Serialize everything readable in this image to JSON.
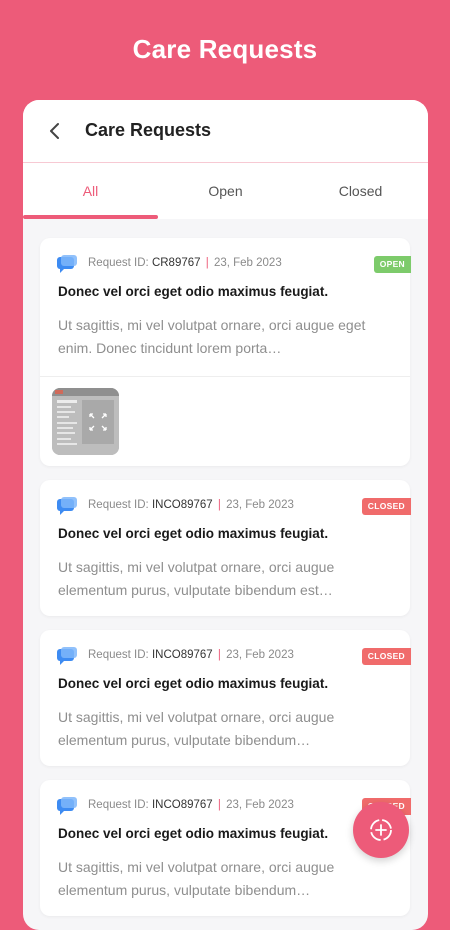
{
  "app": {
    "title": "Care Requests",
    "accent_color": "#ED5B79"
  },
  "header": {
    "title": "Care Requests",
    "back_icon": "chevron-left-icon"
  },
  "tabs": [
    {
      "label": "All",
      "active": true
    },
    {
      "label": "Open",
      "active": false
    },
    {
      "label": "Closed",
      "active": false
    }
  ],
  "requests": [
    {
      "id_label": "Request ID:",
      "id": "CR89767",
      "separator": "|",
      "date": "23, Feb 2023",
      "status": "OPEN",
      "status_color": "#7DCB6B",
      "title": "Donec vel orci eget odio maximus feugiat.",
      "description": "Ut sagittis, mi vel volutpat ornare, orci augue eget enim. Donec tincidunt lorem porta…",
      "has_attachment": true
    },
    {
      "id_label": "Request ID:",
      "id": "INCO89767",
      "separator": "|",
      "date": "23, Feb 2023",
      "status": "CLOSED",
      "status_color": "#F06B6B",
      "title": "Donec vel orci eget odio maximus feugiat.",
      "description": "Ut sagittis, mi vel volutpat ornare, orci augue elementum purus, vulputate bibendum est…"
    },
    {
      "id_label": "Request ID:",
      "id": "INCO89767",
      "separator": "|",
      "date": "23, Feb 2023",
      "status": "CLOSED",
      "status_color": "#F06B6B",
      "title": "Donec vel orci eget odio maximus feugiat.",
      "description": "Ut sagittis, mi vel volutpat ornare, orci augue elementum purus, vulputate bibendum…"
    },
    {
      "id_label": "Request ID:",
      "id": "INCO89767",
      "separator": "|",
      "date": "23, Feb 2023",
      "status": "CLOSED",
      "status_color": "#F06B6B",
      "title": "Donec vel orci eget odio maximus feugiat.",
      "description": "Ut sagittis, mi vel volutpat ornare, orci augue elementum purus, vulputate bibendum…"
    }
  ],
  "fab": {
    "icon": "add-request-icon"
  }
}
